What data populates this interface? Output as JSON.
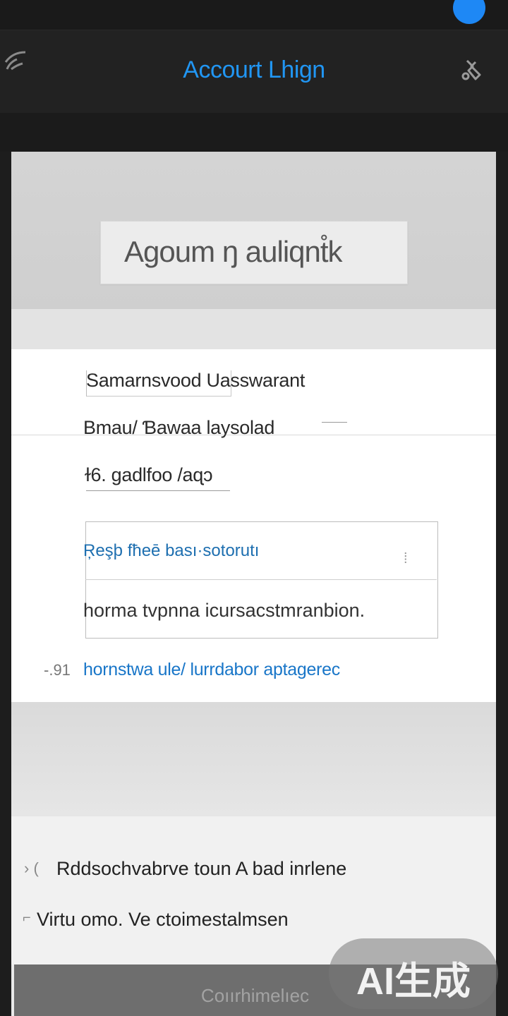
{
  "header": {
    "title": "Accourt Lhign",
    "left_icon": "wifi-icon",
    "right_icon": "settings-icon"
  },
  "hero": {
    "field_text": "Agoum ŋ auliqnt̊k"
  },
  "form": {
    "username_label": "Samarnsvood Uasswarant",
    "email_label": "Bmau/ Ɓawaa laysolad",
    "password_label": "ɫ6. gadlfoo /aɋɔ",
    "input_value": "Ŗeşþ fħeē bası·sotorutı",
    "input_hint": "horma tvpnna icursacstmranbion.",
    "link_prefix": "-.91",
    "link_text": "hornstwa ule/ lurrdabor aptagerec"
  },
  "options": {
    "option1_marker": "›  (",
    "option1_text": "Rddsochvabrve toun A bad inrlene",
    "option2_marker": "⌐",
    "option2_text": "Virtu omo. Ve ctoimestalmsen"
  },
  "footer": {
    "button_label": "Coıırhimelıec"
  },
  "watermark": {
    "text": "AI生成"
  },
  "colors": {
    "accent": "#2196f3",
    "link": "#1976c8",
    "status_dot": "#1e88f5"
  }
}
